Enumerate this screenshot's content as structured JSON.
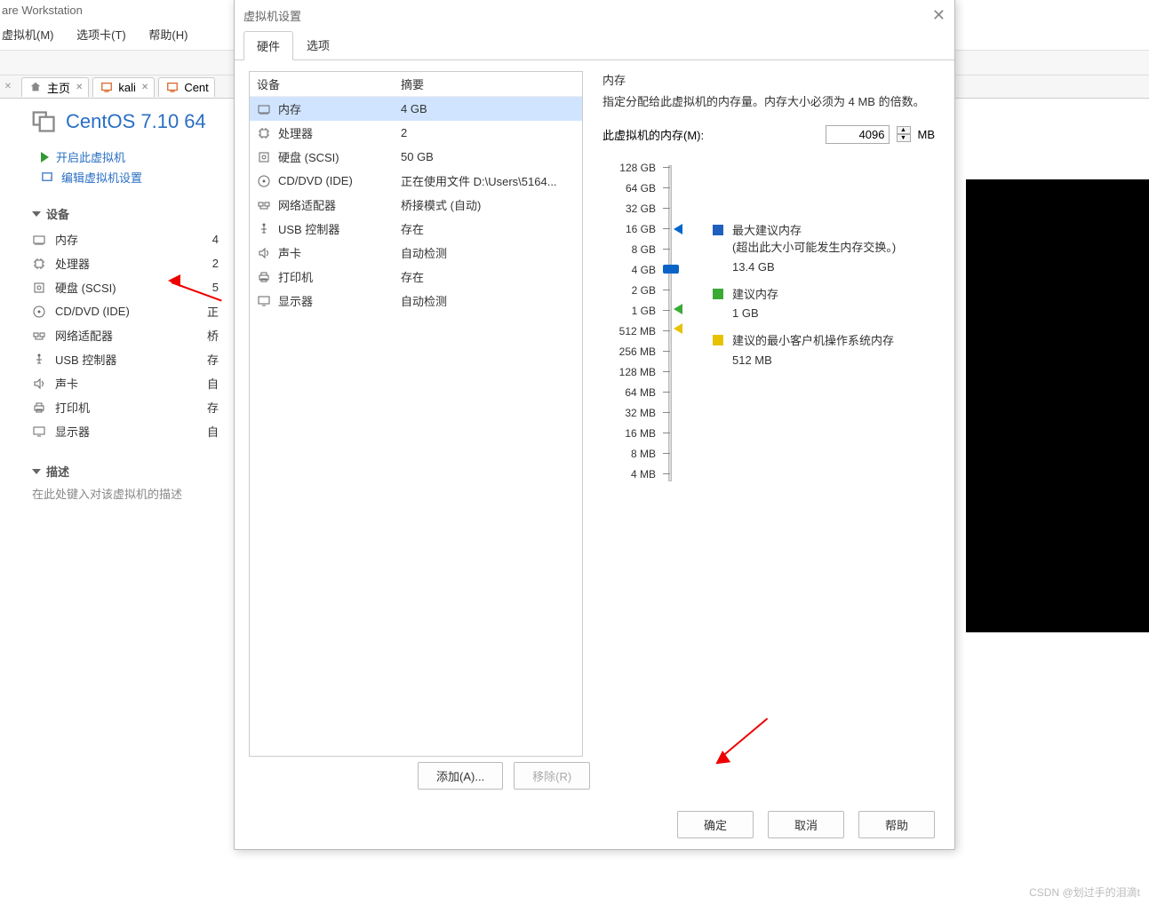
{
  "app_title": "are Workstation",
  "menubar": {
    "vm": "虚拟机(M)",
    "tabs": "选项卡(T)",
    "help": "帮助(H)"
  },
  "tabs": {
    "home": "主页",
    "kali": "kali",
    "cent_partial": "Cent"
  },
  "vm": {
    "title": "CentOS 7.10 64",
    "start": "开启此虚拟机",
    "edit": "编辑虚拟机设置"
  },
  "sections": {
    "devices": "设备",
    "description": "描述"
  },
  "left_devices": [
    {
      "name": "内存",
      "value": "4"
    },
    {
      "name": "处理器",
      "value": "2"
    },
    {
      "name": "硬盘 (SCSI)",
      "value": "5"
    },
    {
      "name": "CD/DVD (IDE)",
      "value": "正"
    },
    {
      "name": "网络适配器",
      "value": "桥"
    },
    {
      "name": "USB 控制器",
      "value": "存"
    },
    {
      "name": "声卡",
      "value": "自"
    },
    {
      "name": "打印机",
      "value": "存"
    },
    {
      "name": "显示器",
      "value": "自"
    }
  ],
  "desc_hint": "在此处键入对该虚拟机的描述",
  "dialog": {
    "title": "虚拟机设置",
    "tab_hw": "硬件",
    "tab_opt": "选项",
    "col_device": "设备",
    "col_summary": "摘要",
    "devices": [
      {
        "name": "内存",
        "summary": "4 GB",
        "sel": true
      },
      {
        "name": "处理器",
        "summary": "2"
      },
      {
        "name": "硬盘 (SCSI)",
        "summary": "50 GB"
      },
      {
        "name": "CD/DVD (IDE)",
        "summary": "正在使用文件 D:\\Users\\5164..."
      },
      {
        "name": "网络适配器",
        "summary": "桥接模式 (自动)"
      },
      {
        "name": "USB 控制器",
        "summary": "存在"
      },
      {
        "name": "声卡",
        "summary": "自动检测"
      },
      {
        "name": "打印机",
        "summary": "存在"
      },
      {
        "name": "显示器",
        "summary": "自动检测"
      }
    ],
    "add": "添加(A)...",
    "remove": "移除(R)",
    "ok": "确定",
    "cancel": "取消",
    "help": "帮助"
  },
  "memory": {
    "title": "内存",
    "desc": "指定分配给此虚拟机的内存量。内存大小必须为 4 MB 的倍数。",
    "field_label": "此虚拟机的内存(M):",
    "value": "4096",
    "unit": "MB",
    "scale": [
      "128 GB",
      "64 GB",
      "32 GB",
      "16 GB",
      "8 GB",
      "4 GB",
      "2 GB",
      "1 GB",
      "512 MB",
      "256 MB",
      "128 MB",
      "64 MB",
      "32 MB",
      "16 MB",
      "8 MB",
      "4 MB"
    ],
    "legend_max": "最大建议内存",
    "legend_max_note": "(超出此大小可能发生内存交换。)",
    "legend_max_val": "13.4 GB",
    "legend_sug": "建议内存",
    "legend_sug_val": "1 GB",
    "legend_min": "建议的最小客户机操作系统内存",
    "legend_min_val": "512 MB"
  },
  "watermark": "CSDN @划过手的泪滴t"
}
